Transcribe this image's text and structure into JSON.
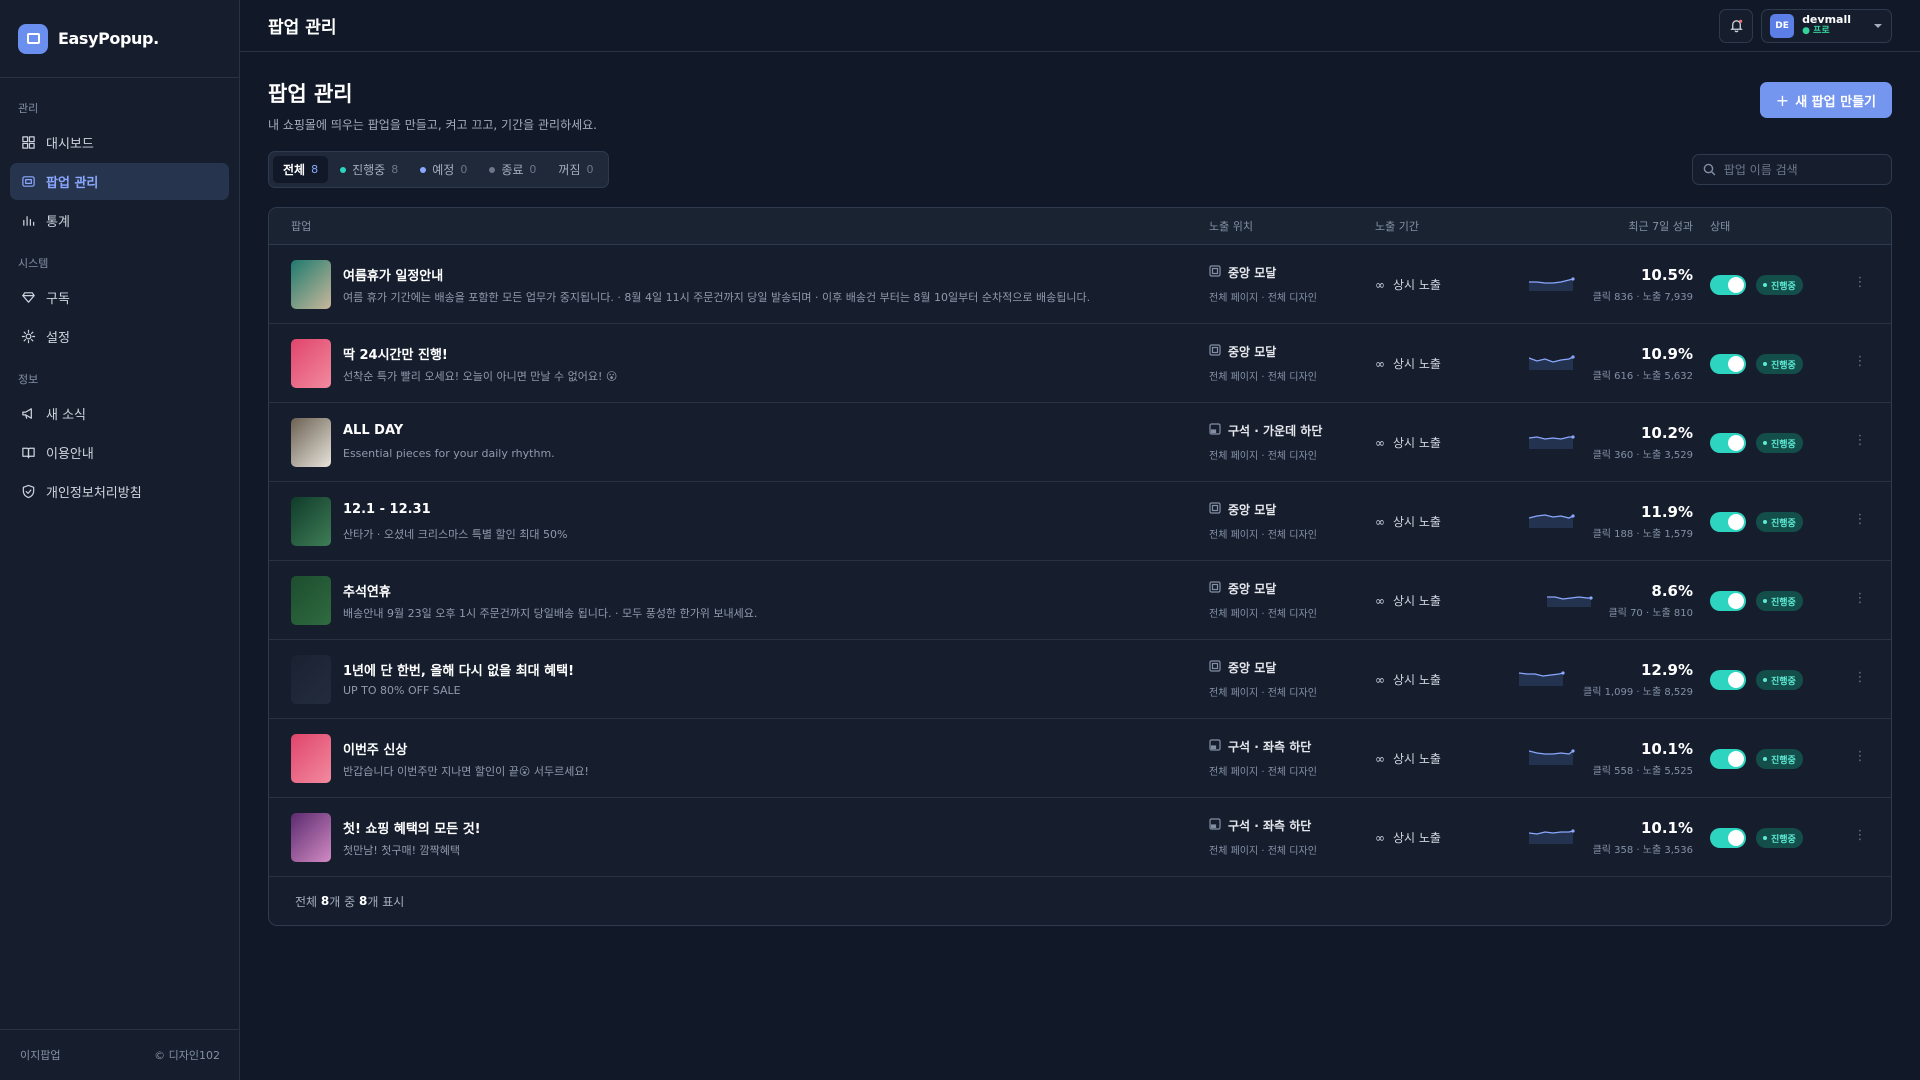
{
  "brand": {
    "name": "EasyPopup."
  },
  "sidebar": {
    "sections": [
      {
        "title": "관리",
        "items": [
          {
            "label": "대시보드",
            "icon": "dashboard-icon"
          },
          {
            "label": "팝업 관리",
            "icon": "popup-icon",
            "active": true
          },
          {
            "label": "통계",
            "icon": "chart-icon"
          }
        ]
      },
      {
        "title": "시스템",
        "items": [
          {
            "label": "구독",
            "icon": "diamond-icon"
          },
          {
            "label": "설정",
            "icon": "gear-icon"
          }
        ]
      },
      {
        "title": "정보",
        "items": [
          {
            "label": "새 소식",
            "icon": "megaphone-icon"
          },
          {
            "label": "이용안내",
            "icon": "book-icon"
          },
          {
            "label": "개인정보처리방침",
            "icon": "shield-icon"
          }
        ]
      }
    ],
    "footer_left": "이지팝업",
    "footer_right": "© 디자인102"
  },
  "topbar": {
    "title": "팝업 관리",
    "user": {
      "initials": "DE",
      "name": "devmall",
      "plan": "● 프로"
    }
  },
  "page": {
    "title": "팝업 관리",
    "subtitle": "내 쇼핑몰에 띄우는 팝업을 만들고, 켜고 끄고, 기간을 관리하세요.",
    "new_button": "새 팝업 만들기",
    "search_placeholder": "팝업 이름 검색"
  },
  "tabs": [
    {
      "label": "전체",
      "count": "8",
      "active": true,
      "dot": ""
    },
    {
      "label": "진행중",
      "count": "8",
      "dot": "#2dd4bf"
    },
    {
      "label": "예정",
      "count": "0",
      "dot": "#8aa8ff"
    },
    {
      "label": "종료",
      "count": "0",
      "dot": "#6b778a"
    },
    {
      "label": "꺼짐",
      "count": "0",
      "dot": ""
    }
  ],
  "table": {
    "headers": {
      "popup": "팝업",
      "position": "노출 위치",
      "period": "노출 기간",
      "perf": "최근 7일 성과",
      "status": "상태"
    },
    "rows": [
      {
        "name": "여름휴가 일정안내",
        "desc": "여름 휴가 기간에는 배송을 포함한 모든 업무가 중지됩니다. · 8월 4일 11시 주문건까지 당일 발송되며 · 이후 배송건 부터는 8월 10일부터 순차적으로 배송됩니다.",
        "position": "중앙 모달",
        "pos_sub": "전체 페이지 · 전체 디자인",
        "period": "상시 노출",
        "pct": "10.5%",
        "stats": "클릭 836 · 노출 7,939",
        "status": "진행중",
        "thumb": [
          "#1f7a6e",
          "#c9b89a"
        ]
      },
      {
        "name": "딱 24시간만 진행!",
        "desc": "선착순 특가 빨리 오세요! 오늘이 아니면 만날 수 없어요! 😮",
        "position": "중앙 모달",
        "pos_sub": "전체 페이지 · 전체 디자인",
        "period": "상시 노출",
        "pct": "10.9%",
        "stats": "클릭 616 · 노출 5,632",
        "status": "진행중",
        "thumb": [
          "#e0456b",
          "#f28aa0"
        ]
      },
      {
        "name": "ALL DAY",
        "desc": "Essential pieces for your daily rhythm.",
        "position": "구석 · 가운데 하단",
        "pos_sub": "전체 페이지 · 전체 디자인",
        "period": "상시 노출",
        "pct": "10.2%",
        "stats": "클릭 360 · 노출 3,529",
        "status": "진행중",
        "thumb": [
          "#6b6152",
          "#e8e4dc"
        ]
      },
      {
        "name": "12.1 - 12.31",
        "desc": "산타가 · 오셨네 크리스마스 특별 할인 최대 50%",
        "position": "중앙 모달",
        "pos_sub": "전체 페이지 · 전체 디자인",
        "period": "상시 노출",
        "pct": "11.9%",
        "stats": "클릭 188 · 노출 1,579",
        "status": "진행중",
        "thumb": [
          "#0f3b2a",
          "#3f7d56"
        ]
      },
      {
        "name": "추석연휴",
        "desc": "배송안내 9월 23일 오후 1시 주문건까지 당일배송 됩니다. · 모두 풍성한 한가위 보내세요.",
        "position": "중앙 모달",
        "pos_sub": "전체 페이지 · 전체 디자인",
        "period": "상시 노출",
        "pct": "8.6%",
        "stats": "클릭 70 · 노출 810",
        "status": "진행중",
        "thumb": [
          "#1d4d2e",
          "#2f6b40"
        ]
      },
      {
        "name": "1년에 단 한번, 올해 다시 없을 최대 혜택!",
        "desc": "UP TO 80% OFF SALE",
        "position": "중앙 모달",
        "pos_sub": "전체 페이지 · 전체 디자인",
        "period": "상시 노출",
        "pct": "12.9%",
        "stats": "클릭 1,099 · 노출 8,529",
        "status": "진행중",
        "thumb": [
          "#1a2232",
          "#232c3d"
        ]
      },
      {
        "name": "이번주 신상",
        "desc": "반갑습니다 이번주만 지나면 할인이 끝😮 서두르세요!",
        "position": "구석 · 좌측 하단",
        "pos_sub": "전체 페이지 · 전체 디자인",
        "period": "상시 노출",
        "pct": "10.1%",
        "stats": "클릭 558 · 노출 5,525",
        "status": "진행중",
        "thumb": [
          "#e0456b",
          "#f28aa0"
        ]
      },
      {
        "name": "첫! 쇼핑 혜택의 모든 것!",
        "desc": "첫만남! 첫구매! 깜짝혜택",
        "position": "구석 · 좌측 하단",
        "pos_sub": "전체 페이지 · 전체 디자인",
        "period": "상시 노출",
        "pct": "10.1%",
        "stats": "클릭 358 · 노출 3,536",
        "status": "진행중",
        "thumb": [
          "#5b2a6e",
          "#d18bc4"
        ]
      }
    ],
    "footer": {
      "prefix": "전체 ",
      "total": "8",
      "mid": "개 중 ",
      "shown": "8",
      "suffix": "개 표시"
    }
  },
  "colors": {
    "accent": "#7596ee",
    "toggle_on": "#2dd4bf",
    "badge_bg": "#134e4a",
    "badge_text": "#5eead4"
  }
}
